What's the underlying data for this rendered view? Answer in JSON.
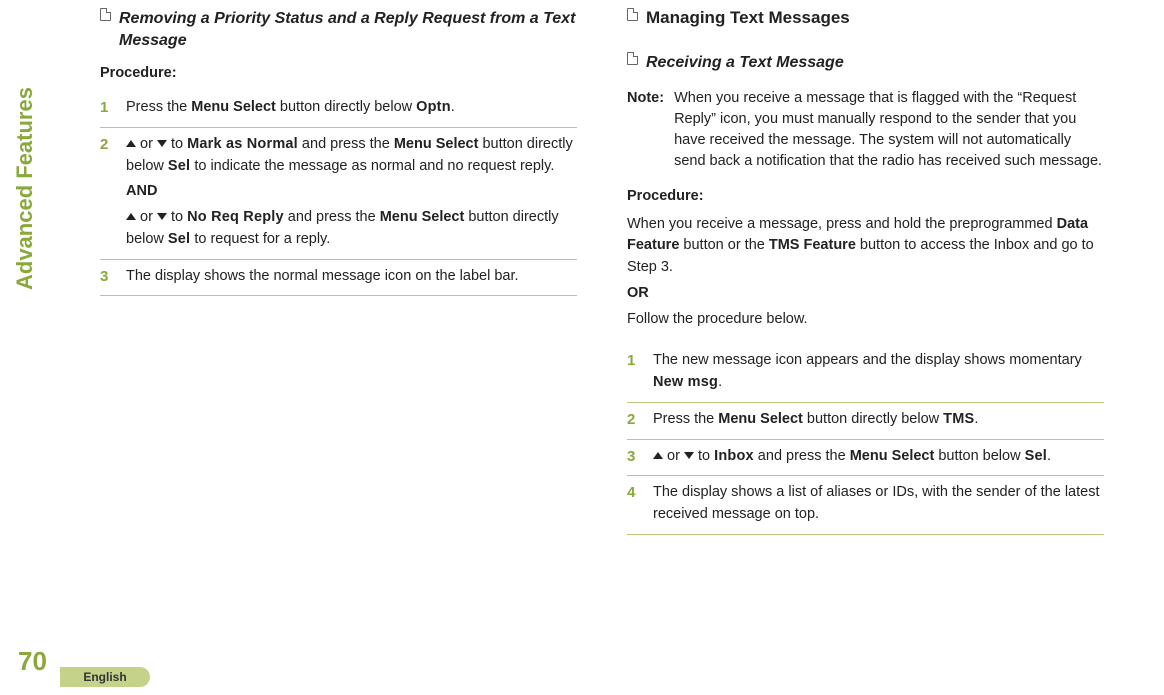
{
  "meta": {
    "side_label": "Advanced Features",
    "page_number": "70",
    "lang_tab": "English"
  },
  "left": {
    "subheading": "Removing a Priority Status and a Reply Request from a Text Message",
    "procedure_label": "Procedure:",
    "steps": {
      "s1": {
        "num": "1",
        "t1": "Press the ",
        "kw1": "Menu Select",
        "t2": " button directly below ",
        "mono1": "Optn",
        "t3": "."
      },
      "s2": {
        "num": "2",
        "or1": " or ",
        "to1": " to ",
        "mono1": "Mark as Normal",
        "t1": " and press the ",
        "kw1": "Menu Select",
        "t2": " button directly below ",
        "mono2": "Sel",
        "t3": " to indicate the message as normal and no request reply.",
        "and": "AND",
        "or2": " or ",
        "to2": " to ",
        "mono3": "No Req Reply",
        "t4": " and press the ",
        "kw2": "Menu Select",
        "t5": " button directly below ",
        "mono4": "Sel",
        "t6": " to request for a reply."
      },
      "s3": {
        "num": "3",
        "t1": "The display shows the normal message icon on the label bar."
      }
    }
  },
  "right": {
    "main_heading": "Managing Text Messages",
    "subheading": "Receiving a Text Message",
    "note_label": "Note:",
    "note_text": "When you receive a message that is flagged with the “Request Reply” icon, you must manually respond to the sender that you have received the message. The system will not automatically send back a notification that the radio has received such message.",
    "procedure_label": "Procedure:",
    "intro": {
      "t1": "When you receive a message, press and hold the preprogrammed ",
      "kw1": "Data Feature",
      "t2": " button or the ",
      "kw2": "TMS Feature",
      "t3": " button to access the Inbox and go to Step 3.",
      "or": "OR",
      "t4": "Follow the procedure below."
    },
    "steps": {
      "s1": {
        "num": "1",
        "t1": "The new message icon appears and the display shows momentary ",
        "mono1": "New msg",
        "t2": "."
      },
      "s2": {
        "num": "2",
        "t1": "Press the ",
        "kw1": "Menu Select",
        "t2": " button directly below ",
        "mono1": "TMS",
        "t3": "."
      },
      "s3": {
        "num": "3",
        "or1": " or ",
        "to1": " to ",
        "mono1": "Inbox",
        "t1": " and press the ",
        "kw1": "Menu Select",
        "t2": " button below ",
        "mono2": "Sel",
        "t3": "."
      },
      "s4": {
        "num": "4",
        "t1": "The display shows a list of aliases or IDs, with the sender of the latest received message on top."
      }
    }
  }
}
